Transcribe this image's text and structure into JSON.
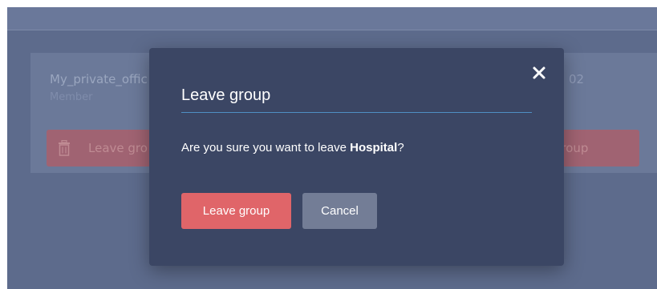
{
  "background": {
    "left_card": {
      "name": "My_private_offic",
      "role": "Member",
      "leave_label": "Leave gro"
    },
    "right_card": {
      "id_fragment": "02",
      "leave_label": "ve group"
    }
  },
  "modal": {
    "title": "Leave group",
    "message_prefix": "Are you sure you want to leave ",
    "group_name": "Hospital",
    "message_suffix": "?",
    "close_icon": "close-icon",
    "leave_button_label": "Leave group",
    "cancel_button_label": "Cancel"
  },
  "colors": {
    "modal_background": "#3b4664",
    "accent_rule": "#4f8fc4",
    "leave_button": "#e06569",
    "cancel_button": "#737d96",
    "overlay_background": "#5d6b8c"
  }
}
